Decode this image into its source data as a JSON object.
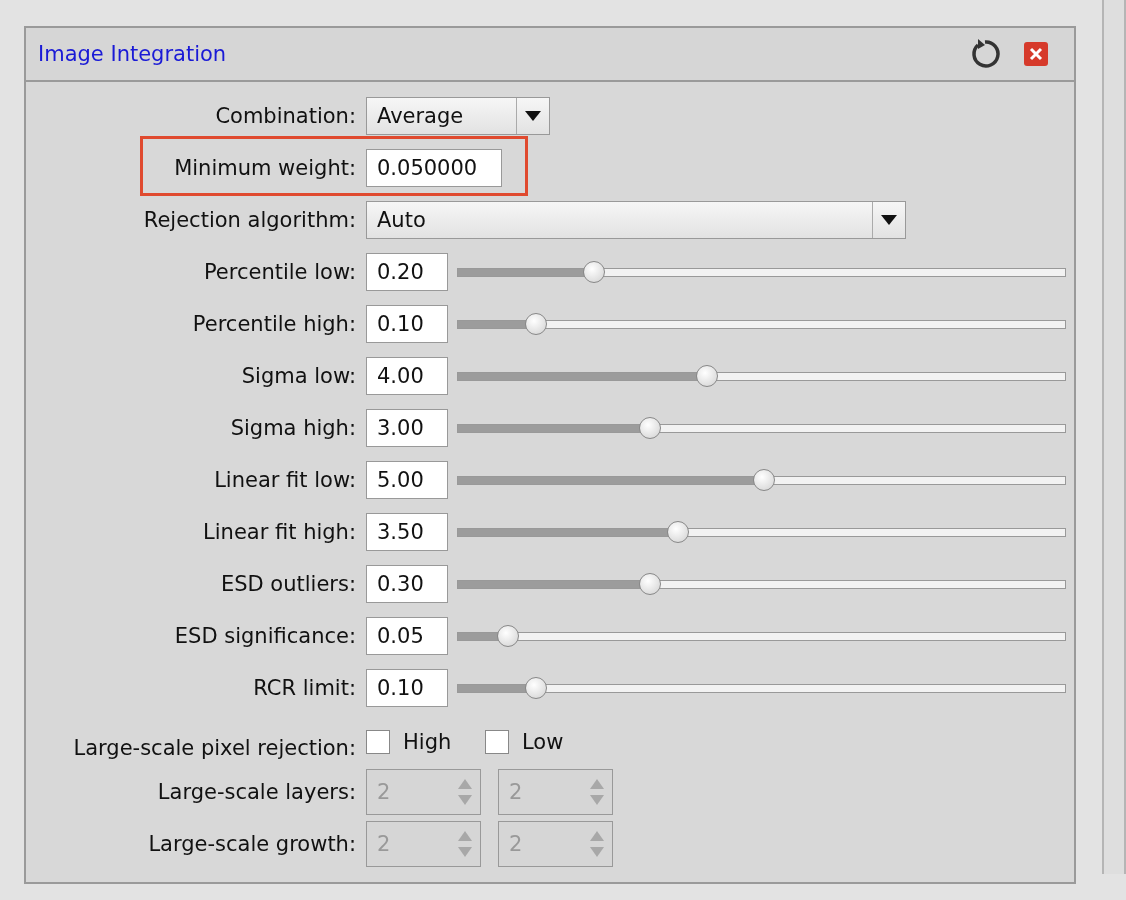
{
  "window": {
    "title": "Image Integration"
  },
  "rows": [
    {
      "kind": "dropdown",
      "label": "Combination:",
      "value": "Average",
      "wide": false,
      "highlighted": false
    },
    {
      "kind": "text",
      "label": "Minimum weight:",
      "value": "0.050000",
      "highlighted": true
    },
    {
      "kind": "dropdown",
      "label": "Rejection algorithm:",
      "value": "Auto",
      "wide": true,
      "highlighted": false
    },
    {
      "kind": "slider",
      "label": "Percentile low:",
      "value": "0.20",
      "level": 0.225
    },
    {
      "kind": "slider",
      "label": "Percentile high:",
      "value": "0.10",
      "level": 0.13
    },
    {
      "kind": "slider",
      "label": "Sigma low:",
      "value": "4.00",
      "level": 0.41
    },
    {
      "kind": "slider",
      "label": "Sigma high:",
      "value": "3.00",
      "level": 0.317
    },
    {
      "kind": "slider",
      "label": "Linear fit low:",
      "value": "5.00",
      "level": 0.504
    },
    {
      "kind": "slider",
      "label": "Linear fit high:",
      "value": "3.50",
      "level": 0.363
    },
    {
      "kind": "slider",
      "label": "ESD outliers:",
      "value": "0.30",
      "level": 0.317
    },
    {
      "kind": "slider",
      "label": "ESD significance:",
      "value": "0.05",
      "level": 0.084
    },
    {
      "kind": "slider",
      "label": "RCR limit:",
      "value": "0.10",
      "level": 0.13
    },
    {
      "kind": "checks",
      "label": "Large-scale pixel rejection:",
      "items": [
        {
          "label": "High",
          "checked": false
        },
        {
          "label": "Low",
          "checked": false
        }
      ]
    },
    {
      "kind": "spins",
      "label": "Large-scale layers:",
      "items": [
        {
          "value": "2",
          "disabled": true
        },
        {
          "value": "2",
          "disabled": true
        }
      ]
    },
    {
      "kind": "spins",
      "label": "Large-scale growth:",
      "items": [
        {
          "value": "2",
          "disabled": true
        },
        {
          "value": "2",
          "disabled": true
        }
      ]
    }
  ]
}
